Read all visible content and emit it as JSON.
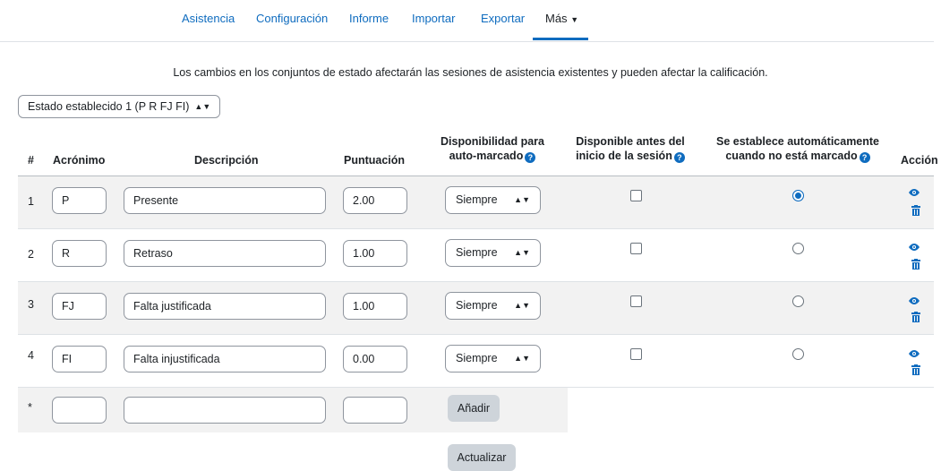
{
  "nav": {
    "tabs": [
      {
        "label": "Asistencia"
      },
      {
        "label": "Configuración"
      },
      {
        "label": "Informe"
      },
      {
        "label": "Importar"
      },
      {
        "label": "Exportar"
      },
      {
        "label": "Más"
      }
    ]
  },
  "notice": "Los cambios en los conjuntos de estado afectarán las sesiones de asistencia existentes y pueden afectar la calificación.",
  "status_set_select": {
    "value": "Estado establecido 1 (P R FJ FI)"
  },
  "table": {
    "headers": {
      "num": "#",
      "acronym": "Acrónimo",
      "description": "Descripción",
      "grade": "Puntuación",
      "automark_l1": "Disponibilidad para",
      "automark_l2": "auto-marcado",
      "before_l1": "Disponible antes del",
      "before_l2": "inicio de la sesión",
      "unmarked_l1": "Se establece automáticamente",
      "unmarked_l2": "cuando no está marcado",
      "action": "Acción"
    },
    "rows": [
      {
        "num": "1",
        "acronym": "P",
        "description": "Presente",
        "grade": "2.00",
        "automark": "Siempre",
        "available_before": false,
        "set_unmarked": true
      },
      {
        "num": "2",
        "acronym": "R",
        "description": "Retraso",
        "grade": "1.00",
        "automark": "Siempre",
        "available_before": false,
        "set_unmarked": false
      },
      {
        "num": "3",
        "acronym": "FJ",
        "description": "Falta justificada",
        "grade": "1.00",
        "automark": "Siempre",
        "available_before": false,
        "set_unmarked": false
      },
      {
        "num": "4",
        "acronym": "FI",
        "description": "Falta injustificada",
        "grade": "0.00",
        "automark": "Siempre",
        "available_before": false,
        "set_unmarked": false
      }
    ],
    "new_row": {
      "num": "*",
      "add_label": "Añadir"
    }
  },
  "update_label": "Actualizar",
  "icons": {
    "help": "help-icon",
    "view": "eye-icon",
    "delete": "trash-icon"
  },
  "colors": {
    "accent": "#0f6cbf",
    "button_bg": "#ced4da",
    "stripe": "#f2f2f2"
  }
}
